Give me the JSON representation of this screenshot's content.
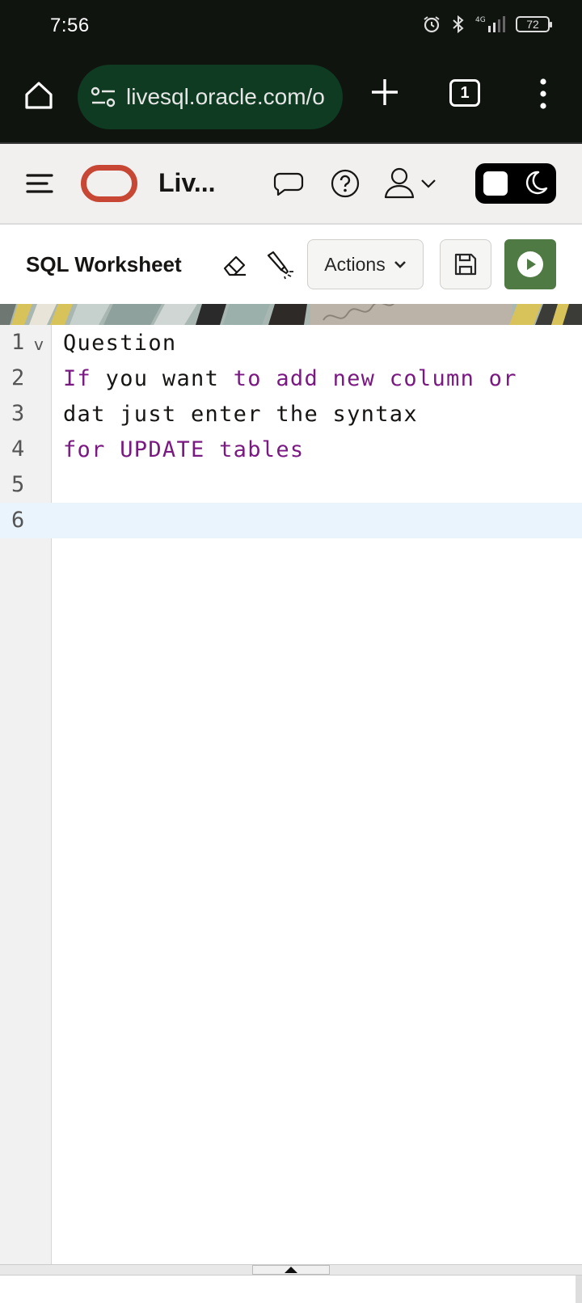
{
  "status_bar": {
    "time": "7:56",
    "battery": "72",
    "network": "4G"
  },
  "browser": {
    "url": "livesql.oracle.com/o",
    "tab_count": "1"
  },
  "app_header": {
    "title": "Liv...",
    "brand_color": "#c74634"
  },
  "worksheet": {
    "title": "SQL Worksheet",
    "actions_label": "Actions",
    "run_color": "#4f7a43"
  },
  "editor": {
    "lines": [
      {
        "num": "1",
        "text": "Question"
      },
      {
        "num": "2",
        "text": "If you want to add new column or"
      },
      {
        "num": "3",
        "text": "dat just enter the syntax"
      },
      {
        "num": "4",
        "text": "for UPDATE tables"
      },
      {
        "num": "5",
        "text": ""
      },
      {
        "num": "6",
        "text": ""
      }
    ],
    "active_line": "6",
    "keyword_color": "#7a1982"
  }
}
